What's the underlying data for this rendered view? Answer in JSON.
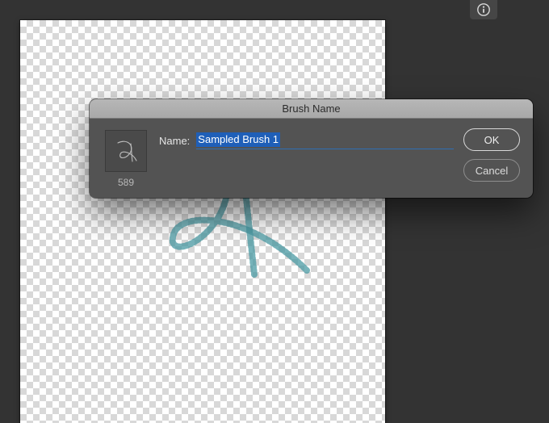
{
  "dialog": {
    "title": "Brush Name",
    "name_label": "Name:",
    "name_value": "Sampled Brush 1",
    "thumb_size": "589",
    "ok_label": "OK",
    "cancel_label": "Cancel"
  },
  "icons": {
    "info": "info-icon",
    "brush_thumb": "brush-thumb-icon"
  },
  "colors": {
    "dialog_bg": "#535353",
    "app_bg": "#333333",
    "selection": "#1f5fb8",
    "stroke": "#4a9aa3"
  }
}
